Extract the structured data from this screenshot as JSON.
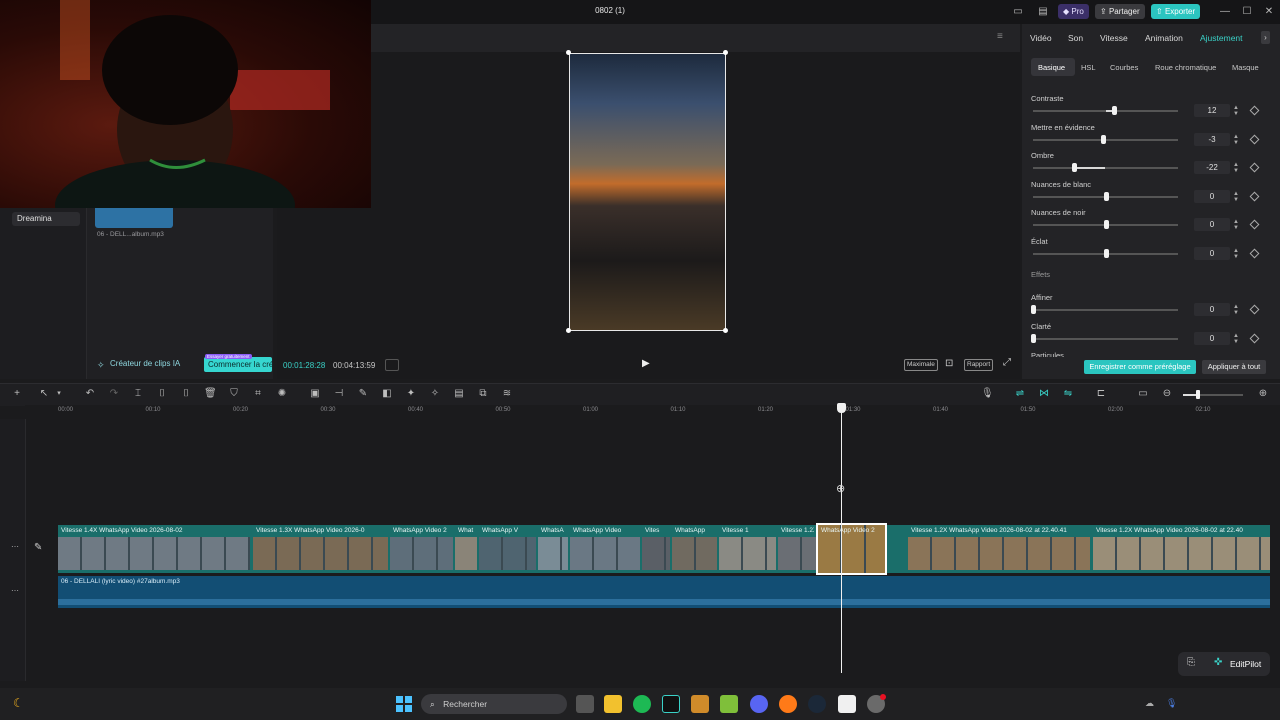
{
  "window": {
    "title": "0802 (1)"
  },
  "topbar": {
    "pro_label": "Pro",
    "share_label": "Partager",
    "export_label": "Exporter"
  },
  "left_panel": {
    "nav_item": "Dreamina",
    "media_name": "06 - DELL...album.mp3",
    "ai_clips_label": "Créateur de clips IA",
    "start_label": "Commencer la création",
    "free_tag": "Essayer gratuitement"
  },
  "player": {
    "current_time": "00:01:28:28",
    "total_time": "00:04:13:59",
    "max_label": "Maximale",
    "ratio_label": "Rapport"
  },
  "right_panel": {
    "tabs": [
      "Vidéo",
      "Son",
      "Vitesse",
      "Animation",
      "Ajustement"
    ],
    "active_tab": "Ajustement",
    "subtabs": [
      "Basique",
      "HSL",
      "Courbes",
      "Roue chromatique",
      "Masque"
    ],
    "active_subtab": "Basique",
    "params": [
      {
        "label": "Contraste",
        "value": "12",
        "level": 0.56
      },
      {
        "label": "Mettre en évidence",
        "value": "-3",
        "level": 0.48
      },
      {
        "label": "Ombre",
        "value": "-22",
        "level": 0.28
      },
      {
        "label": "Nuances de blanc",
        "value": "0",
        "level": 0.5
      },
      {
        "label": "Nuances de noir",
        "value": "0",
        "level": 0.5
      },
      {
        "label": "Éclat",
        "value": "0",
        "level": 0.5
      }
    ],
    "effects_heading": "Effets",
    "effect_params": [
      {
        "label": "Affiner",
        "value": "0",
        "level": 0.0
      },
      {
        "label": "Clarté",
        "value": "0",
        "level": 0.0
      }
    ],
    "cut_label": "Particules",
    "save_preset_label": "Enregistrer comme préréglage",
    "apply_all_label": "Appliquer à tout"
  },
  "timeline": {
    "ruler": [
      "00:00",
      "00:10",
      "00:20",
      "00:30",
      "00:40",
      "00:50",
      "01:00",
      "01:10",
      "01:20",
      "01:30",
      "01:40",
      "01:50",
      "02:00",
      "02:10"
    ],
    "clips": [
      {
        "label": "Vitesse 1.4X   WhatsApp Video 2026-08-02"
      },
      {
        "label": "Vitesse 1.3X   WhatsApp Video 2026-0"
      },
      {
        "label": "WhatsApp Video 2"
      },
      {
        "label": "What"
      },
      {
        "label": "WhatsApp V"
      },
      {
        "label": "WhatsA"
      },
      {
        "label": "WhatsApp Video"
      },
      {
        "label": "Vites"
      },
      {
        "label": "WhatsApp"
      },
      {
        "label": "Vitesse 1"
      },
      {
        "label": "Vitesse 1.2X"
      },
      {
        "label": "WhatsApp Video 2"
      },
      {
        "label": "Vitesse 1.2X   WhatsApp Video 2026-08-02 at 22.40.41"
      },
      {
        "label": "Vitesse 1.2X   WhatsApp Video 2026-08-02 at 22.40"
      }
    ],
    "audio_label": "06 - DELLALI (lyric video) #27album.mp3",
    "editpilot_label": "EditPilot"
  },
  "taskbar": {
    "search_placeholder": "Rechercher"
  },
  "colors": {
    "accent": "#2bc5c0",
    "video_track": "#1a6e6a",
    "audio_track": "#124e74"
  }
}
